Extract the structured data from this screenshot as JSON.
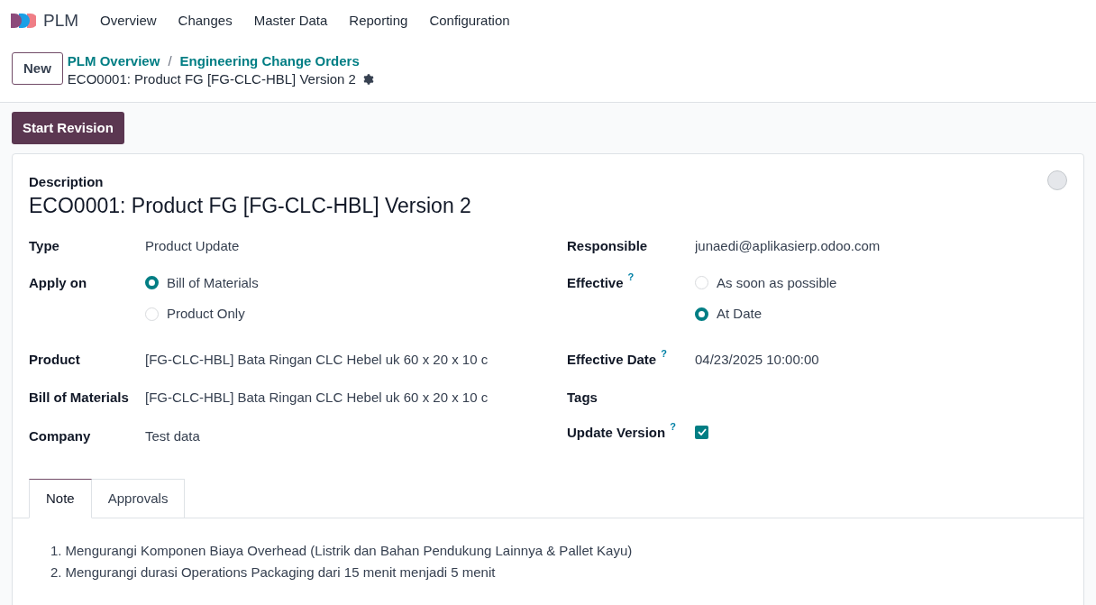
{
  "app": {
    "name": "PLM"
  },
  "menu": [
    {
      "label": "Overview"
    },
    {
      "label": "Changes"
    },
    {
      "label": "Master Data"
    },
    {
      "label": "Reporting"
    },
    {
      "label": "Configuration"
    }
  ],
  "new_button": "New",
  "breadcrumbs": [
    "PLM Overview",
    "Engineering Change Orders"
  ],
  "breadcrumb_separator": "/",
  "record_title": "ECO0001: Product FG [FG-CLC-HBL] Version 2",
  "action_button": "Start Revision",
  "form": {
    "description_label": "Description",
    "description": "ECO0001: Product FG [FG-CLC-HBL] Version 2",
    "left_fields": [
      {
        "kind": "text",
        "label": "Type",
        "value": "Product Update"
      },
      {
        "kind": "radio",
        "label": "Apply on",
        "options": [
          {
            "label": "Bill of Materials",
            "selected": true
          },
          {
            "label": "Product Only",
            "selected": false
          }
        ]
      },
      {
        "kind": "text",
        "label": "Product",
        "value": "[FG-CLC-HBL] Bata Ringan CLC Hebel uk 60 x 20 x 10 c"
      },
      {
        "kind": "text",
        "label": "Bill of Materials",
        "value": "[FG-CLC-HBL] Bata Ringan CLC Hebel uk 60 x 20 x 10 c"
      },
      {
        "kind": "text",
        "label": "Company",
        "value": "Test data"
      }
    ],
    "right_fields": [
      {
        "kind": "text",
        "label": "Responsible",
        "value": "junaedi@aplikasierp.odoo.com"
      },
      {
        "kind": "radio",
        "label": "Effective",
        "help": "?",
        "options": [
          {
            "label": "As soon as possible",
            "selected": false
          },
          {
            "label": "At Date",
            "selected": true
          }
        ]
      },
      {
        "kind": "text",
        "label": "Effective Date",
        "help": "?",
        "value": "04/23/2025 10:00:00"
      },
      {
        "kind": "text",
        "label": "Tags"
      },
      {
        "kind": "checkbox",
        "label": "Update Version",
        "help": "?",
        "checked": true
      }
    ]
  },
  "tabs": [
    {
      "label": "Note",
      "selected": true
    },
    {
      "label": "Approvals",
      "selected": false
    }
  ],
  "note": [
    {
      "marker": "1.",
      "text": "Mengurangi Komponen Biaya Overhead (Listrik dan Bahan Pendukung Lainnya & Pallet Kayu)"
    },
    {
      "marker": "2.",
      "text": "Mengurangi durasi Operations Packaging dari 15 menit menjadi 5 menit"
    }
  ]
}
